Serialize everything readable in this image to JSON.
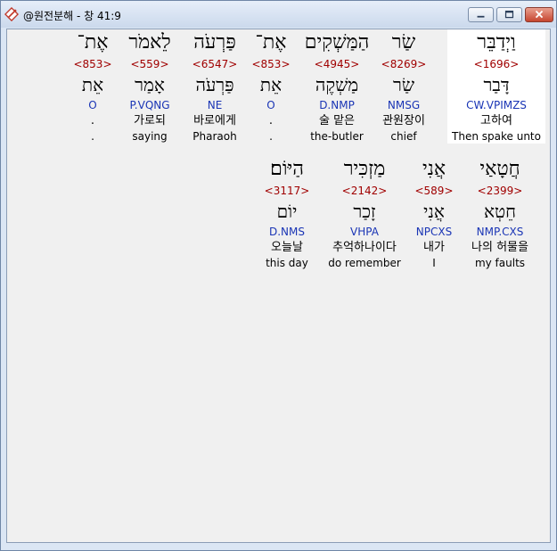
{
  "window": {
    "title": "@원전분해 - 창 41:9"
  },
  "colors": {
    "strong": "#a00000",
    "morph": "#1a35b5",
    "highlight": "#ffffff",
    "background": "#f0f0f0"
  },
  "icons": {
    "app": "diamond-pen-icon",
    "minimize": "minimize-icon",
    "maximize": "maximize-icon",
    "close": "close-icon"
  },
  "words": [
    {
      "heb": "וַיְדַבֵּר",
      "strong": "<1696>",
      "lemma": "דָּבַר",
      "morph": "CW.VPIMZS",
      "ko": "고하여",
      "en": "Then spake unto",
      "highlight": true
    },
    {
      "heb": "שַׂר",
      "strong": "<8269>",
      "lemma": "שַׂר",
      "morph": "NMSG",
      "ko": "관원장이",
      "en": "chief"
    },
    {
      "heb": "הַמַּשְׁקִים",
      "strong": "<4945>",
      "lemma": "מַשְׁקֶה",
      "morph": "D.NMP",
      "ko": "술 맡은",
      "en": "the-butler"
    },
    {
      "heb": "אֶת־",
      "strong": "<853>",
      "lemma": "אֵת",
      "morph": "O",
      "ko": ".",
      "en": "."
    },
    {
      "heb": "פַּרְעֹה",
      "strong": "<6547>",
      "lemma": "פַּרְעֹה",
      "morph": "NE",
      "ko": "바로에게",
      "en": "Pharaoh"
    },
    {
      "heb": "לֵאמֹר",
      "strong": "<559>",
      "lemma": "אָמַר",
      "morph": "P.VQNG",
      "ko": "가로되",
      "en": "saying"
    },
    {
      "heb": "אֶת־",
      "strong": "<853>",
      "lemma": "אֵת",
      "morph": "O",
      "ko": ".",
      "en": "."
    },
    {
      "heb": "חֲטָאַי",
      "strong": "<2399>",
      "lemma": "חֵטְא",
      "morph": "NMP.CXS",
      "ko": "나의 허물을",
      "en": "my faults"
    },
    {
      "heb": "אֲנִי",
      "strong": "<589>",
      "lemma": "אֲנִי",
      "morph": "NPCXS",
      "ko": "내가",
      "en": "I"
    },
    {
      "heb": "מַזְכִּיר",
      "strong": "<2142>",
      "lemma": "זָכַר",
      "morph": "VHPA",
      "ko": "추억하나이다",
      "en": "do remember"
    },
    {
      "heb": "הַיּוֹם׃",
      "strong": "<3117>",
      "lemma": "יוֹם",
      "morph": "D.NMS",
      "ko": "오늘날",
      "en": "this day"
    }
  ]
}
